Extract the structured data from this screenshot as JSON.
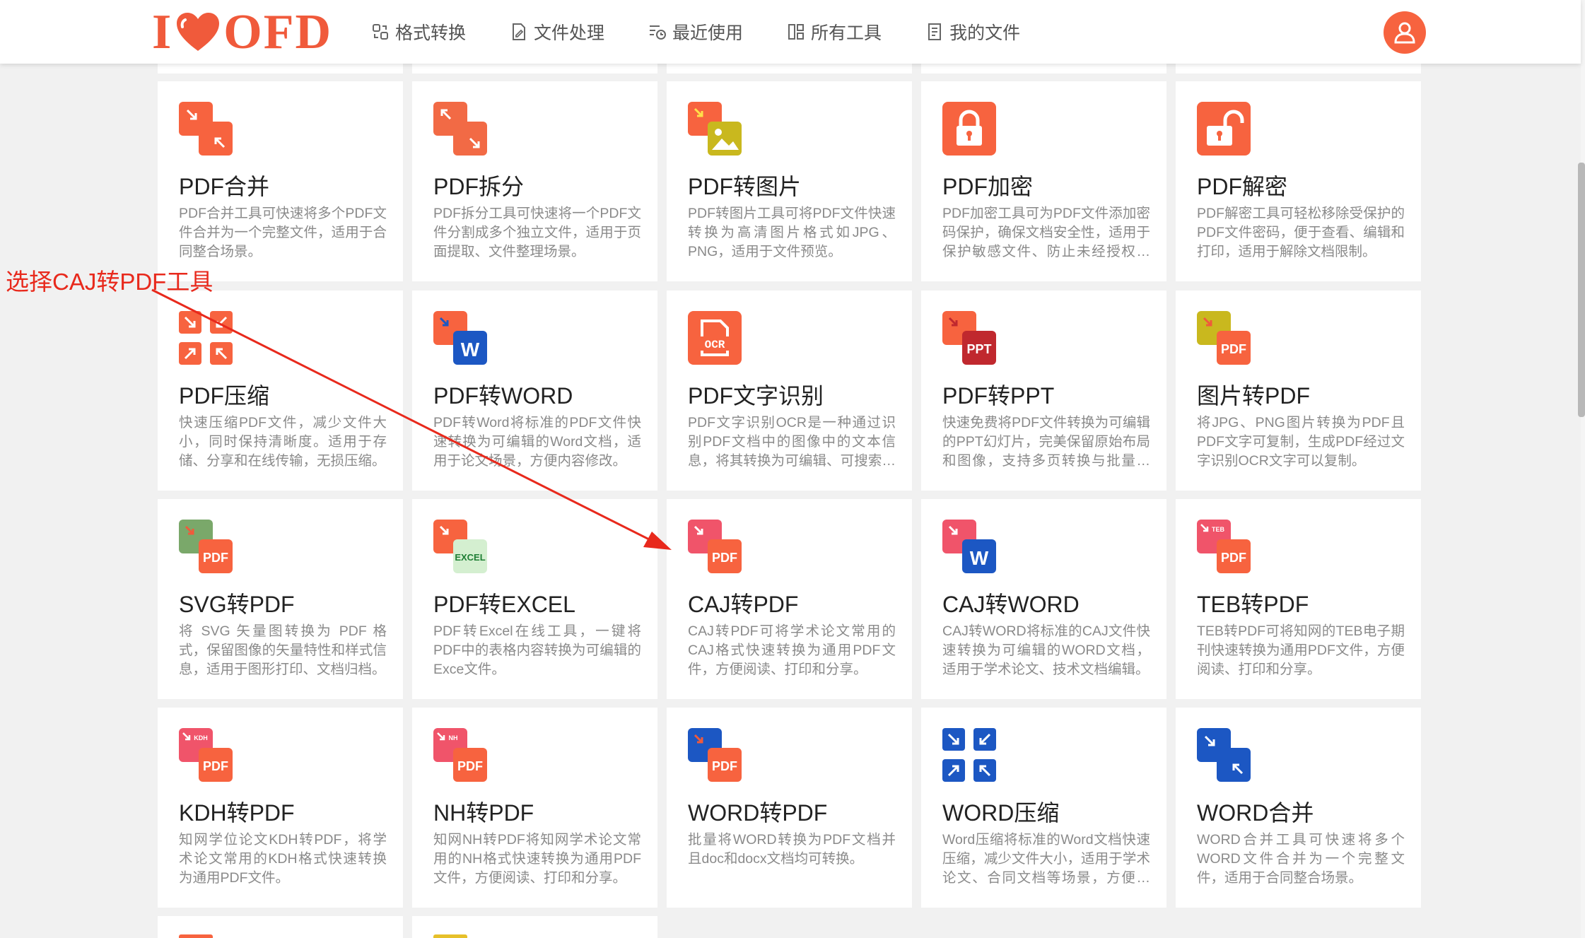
{
  "header": {
    "logo": {
      "text_i": "I",
      "text_ofd": "OFD"
    },
    "nav": [
      {
        "label": "格式转换",
        "icon": "convert-icon"
      },
      {
        "label": "文件处理",
        "icon": "file-edit-icon"
      },
      {
        "label": "最近使用",
        "icon": "recent-icon"
      },
      {
        "label": "所有工具",
        "icon": "all-tools-icon"
      },
      {
        "label": "我的文件",
        "icon": "my-files-icon"
      }
    ],
    "avatar_icon": "user-icon"
  },
  "annotation": {
    "label": "选择CAJ转PDF工具",
    "color": "#e8291c"
  },
  "colors": {
    "accent": "#f7633f",
    "word_blue": "#1c57c3",
    "ppt_red": "#c0282e",
    "excel_green": "#1e7e34"
  },
  "tools": [
    {
      "title": "PDF合并",
      "desc": "PDF合并工具可快速将多个PDF文件合并为一个完整文件，适用于合同整合场景。",
      "icon": "merge-icon"
    },
    {
      "title": "PDF拆分",
      "desc": "PDF拆分工具可快速将一个PDF文件分割成多个独立文件，适用于页面提取、文件整理场景。",
      "icon": "split-icon"
    },
    {
      "title": "PDF转图片",
      "desc": "PDF转图片工具可将PDF文件快速转换为高清图片格式如JPG、PNG，适用于文件预览。",
      "icon": "pdf-to-image-icon"
    },
    {
      "title": "PDF加密",
      "desc": "PDF加密工具可为PDF文件添加密码保护，确保文档安全性，适用于保护敏感文件、防止未经授权访问。",
      "icon": "lock-icon"
    },
    {
      "title": "PDF解密",
      "desc": "PDF解密工具可轻松移除受保护的PDF文件密码，便于查看、编辑和打印，适用于解除文档限制。",
      "icon": "unlock-icon"
    },
    {
      "title": "PDF压缩",
      "desc": "快速压缩PDF文件，减少文件大小，同时保持清晰度。适用于存储、分享和在线传输，无损压缩。",
      "icon": "compress-icon"
    },
    {
      "title": "PDF转WORD",
      "desc": "PDF转Word将标准的PDF文件快速转换为可编辑的Word文档，适用于论文场景，方便内容修改。",
      "icon": "pdf-to-word-icon",
      "badge": "W"
    },
    {
      "title": "PDF文字识别",
      "desc": "PDF文字识别OCR是一种通过识别PDF文档中的图像中的文本信息，将其转换为可编辑、可搜索的文本。",
      "icon": "ocr-icon",
      "badge": "OCR"
    },
    {
      "title": "PDF转PPT",
      "desc": "快速免费将PDF文件转换为可编辑的PPT幻灯片，完美保留原始布局和图像，支持多页转换与批量处理。",
      "icon": "pdf-to-ppt-icon",
      "badge": "PPT"
    },
    {
      "title": "图片转PDF",
      "desc": "将JPG、PNG图片转换为PDF且PDF文字可复制，生成PDF经过文字识别OCR文字可以复制。",
      "icon": "image-to-pdf-icon",
      "badge": "PDF"
    },
    {
      "title": "SVG转PDF",
      "desc": "将 SVG 矢量图转换为 PDF 格式，保留图像的矢量特性和样式信息，适用于图形打印、文档归档。",
      "icon": "svg-to-pdf-icon",
      "badge": "PDF"
    },
    {
      "title": "PDF转EXCEL",
      "desc": "PDF转Excel在线工具，一键将PDF中的表格内容转换为可编辑的Exce文件。",
      "icon": "pdf-to-excel-icon",
      "badge": "EXCEL"
    },
    {
      "title": "CAJ转PDF",
      "desc": "CAJ转PDF可将学术论文常用的CAJ格式快速转换为通用PDF文件，方便阅读、打印和分享。",
      "icon": "caj-to-pdf-icon",
      "badge": "PDF"
    },
    {
      "title": "CAJ转WORD",
      "desc": "CAJ转WORD将标准的CAJ文件快速转换为可编辑的WORD文档，适用于学术论文、技术文档编辑。",
      "icon": "caj-to-word-icon",
      "badge": "W"
    },
    {
      "title": "TEB转PDF",
      "desc": "TEB转PDF可将知网的TEB电子期刊快速转换为通用PDF文件，方便阅读、打印和分享。",
      "icon": "teb-to-pdf-icon",
      "badge": "PDF",
      "tag": "TEB"
    },
    {
      "title": "KDH转PDF",
      "desc": "知网学位论文KDH转PDF，将学术论文常用的KDH格式快速转换为通用PDF文件。",
      "icon": "kdh-to-pdf-icon",
      "badge": "PDF",
      "tag": "KDH"
    },
    {
      "title": "NH转PDF",
      "desc": "知网NH转PDF将知网学术论文常用的NH格式快速转换为通用PDF文件，方便阅读、打印和分享。",
      "icon": "nh-to-pdf-icon",
      "badge": "PDF",
      "tag": "NH"
    },
    {
      "title": "WORD转PDF",
      "desc": "批量将WORD转换为PDF文档并且doc和docx文档均可转换。",
      "icon": "word-to-pdf-icon",
      "badge": "PDF"
    },
    {
      "title": "WORD压缩",
      "desc": "Word压缩将标准的Word文档快速压缩，减少文件大小，适用于学术论文、合同文档等场景，方便传输。",
      "icon": "word-compress-icon"
    },
    {
      "title": "WORD合并",
      "desc": "WORD合并工具可快速将多个WORD文件合并为一个完整文件，适用于合同整合场景。",
      "icon": "word-merge-icon"
    }
  ]
}
